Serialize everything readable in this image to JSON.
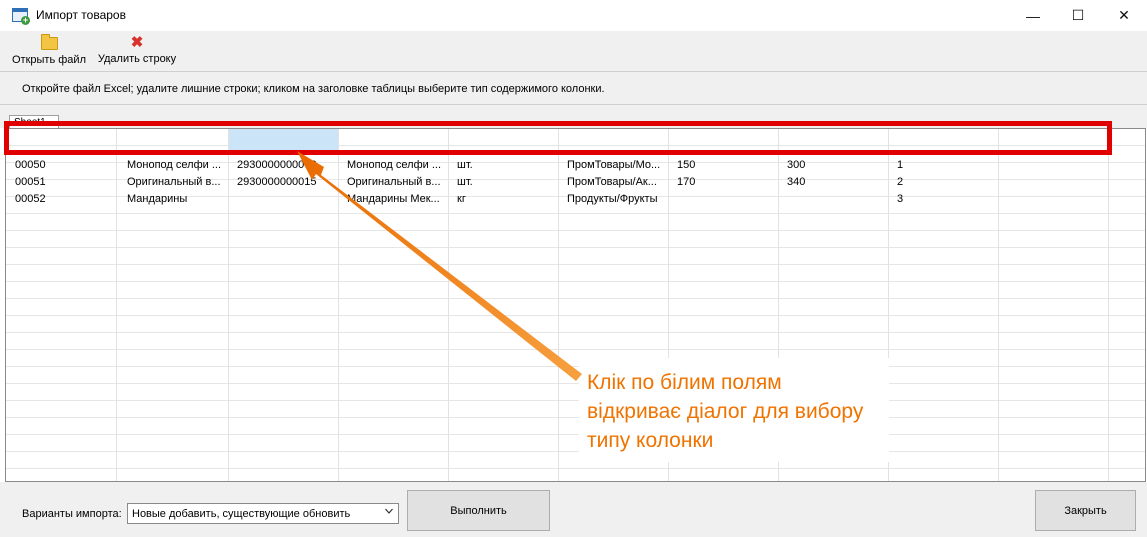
{
  "window": {
    "title": "Импорт товаров",
    "minimize_symbol": "—",
    "maximize_symbol": "☐",
    "close_symbol": "✕"
  },
  "toolbar": {
    "open_label": "Открыть файл",
    "open_icon": "folder-icon",
    "delete_label": "Удалить строку",
    "delete_icon": "delete-icon",
    "delete_symbol": "✖"
  },
  "info": {
    "text": "Откройте файл Excel;  удалите лишние строки;  кликом на заголовке таблицы выберите тип содержимого колонки."
  },
  "sheet_tab": {
    "label": "Sheet1"
  },
  "grid": {
    "rows": [
      [
        "00050",
        "Монопод селфи ...",
        "2930000000008",
        "Монопод селфи ...",
        "шт.",
        "ПромТовары/Мо...",
        "150",
        "300",
        "1"
      ],
      [
        "00051",
        "Оригинальный в...",
        "2930000000015",
        "Оригинальный в...",
        "шт.",
        "ПромТовары/Ак...",
        "170",
        "340",
        "2"
      ],
      [
        "00052",
        "Мандарины",
        "",
        "Мандарины Мек...",
        "кг",
        "Продукты/Фрукты",
        "",
        "",
        "3"
      ]
    ]
  },
  "annotation": {
    "line1": "Клік по білим полям",
    "line2": "відкриває діалог для вибору",
    "line3": "типу колонки",
    "border_color": "#e00000",
    "arrow_color": "#f07300"
  },
  "footer": {
    "import_label": "Варианты импорта:",
    "import_value": "Новые добавить, существующие обновить",
    "execute_label": "Выполнить",
    "close_label": "Закрыть"
  }
}
